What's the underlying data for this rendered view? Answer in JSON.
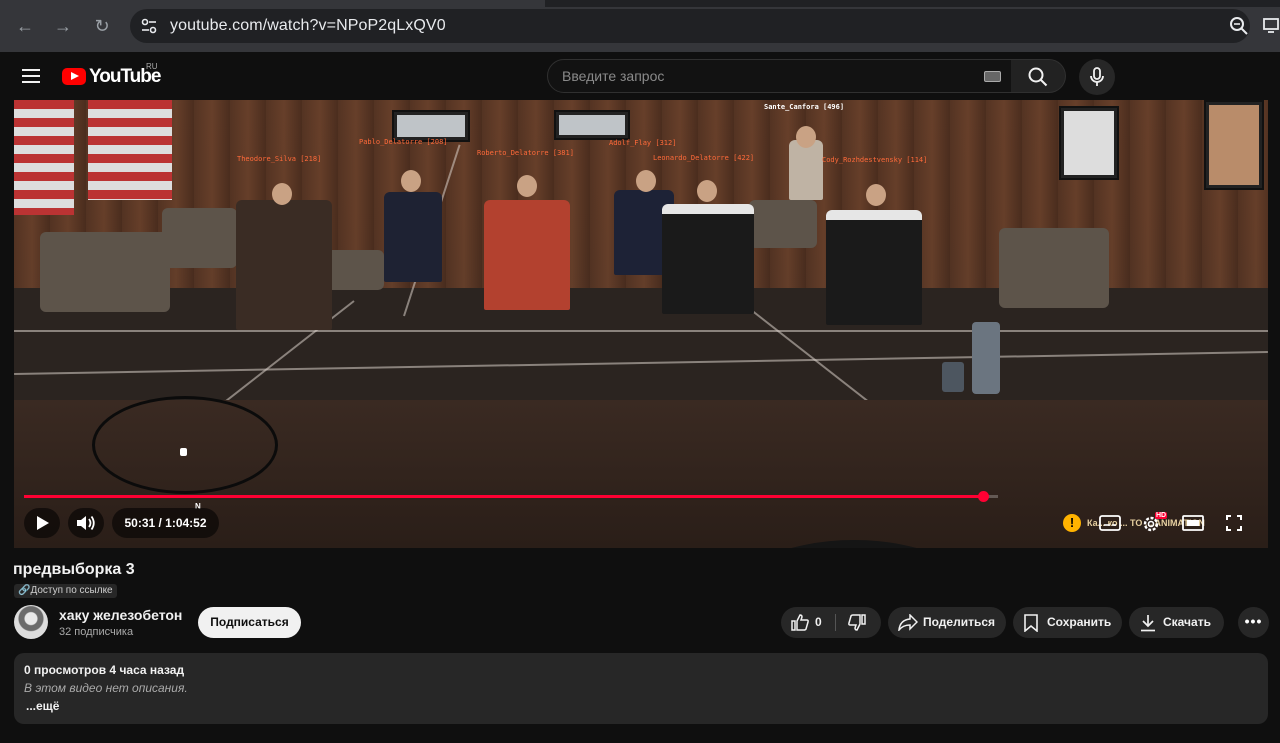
{
  "browser": {
    "url": "youtube.com/watch?v=NPoP2qLxQV0"
  },
  "header": {
    "logo_text": "YouTube",
    "region": "RU",
    "search_placeholder": "Введите запрос"
  },
  "video": {
    "name_tags": [
      "Theodore_Silva [218]",
      "Pablo_Delatorre [208]",
      "Roberto_Delatorre [381]",
      "Adolf_Flay [312]",
      "Leonardo_Delatorre [422]",
      "Sante_Canfora [496]",
      "Cody_Rozhdestvensky [114]"
    ],
    "overlay_text": "Ка... ко ... TO ... ANIMATION",
    "compass": "N"
  },
  "player": {
    "time": "50:31 / 1:04:52",
    "progress": 0.985,
    "settings_badge": "HD"
  },
  "meta": {
    "title": "предвыборка 3",
    "access": "Доступ по ссылке",
    "channel_name": "хаку железобетон",
    "subscribers": "32 подписчика",
    "subscribe_label": "Подписаться",
    "likes": "0",
    "share_label": "Поделиться",
    "save_label": "Сохранить",
    "download_label": "Скачать",
    "more_label": "•••"
  },
  "description": {
    "meta": "0 просмотров  4 часа назад",
    "text": "В этом видео нет описания.",
    "more": "...ещё"
  },
  "colors": {
    "background": "#0f0f0f",
    "accent": "#ff0033",
    "pill": "#272727"
  }
}
